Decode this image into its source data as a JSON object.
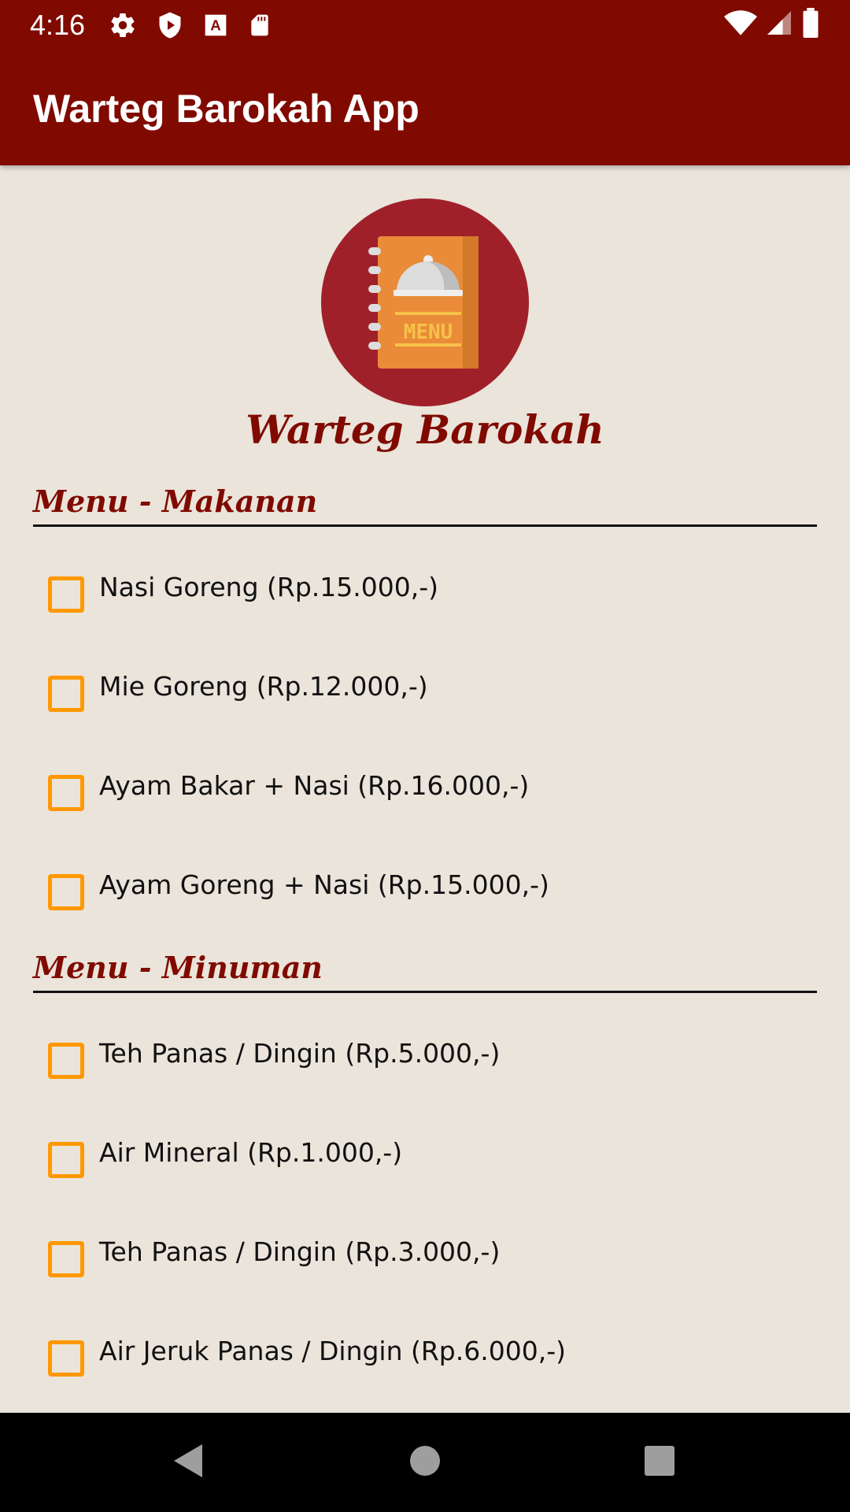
{
  "status_bar": {
    "time": "4:16",
    "left_icons": [
      "gear-icon",
      "shield-play-icon",
      "font-a-icon",
      "sd-card-icon"
    ],
    "right_icons": [
      "wifi-icon",
      "signal-icon",
      "battery-icon"
    ]
  },
  "app_bar": {
    "title": "Warteg Barokah App",
    "color": "#800A00"
  },
  "logo": {
    "icon": "menu-book-icon",
    "text": "MENU"
  },
  "brand_name": "Warteg Barokah",
  "sections": [
    {
      "title": "Menu - Makanan",
      "items": [
        {
          "label": "Nasi Goreng (Rp.15.000,-)",
          "checked": false
        },
        {
          "label": "Mie Goreng (Rp.12.000,-)",
          "checked": false
        },
        {
          "label": "Ayam Bakar + Nasi (Rp.16.000,-)",
          "checked": false
        },
        {
          "label": "Ayam Goreng + Nasi (Rp.15.000,-)",
          "checked": false
        }
      ]
    },
    {
      "title": "Menu - Minuman",
      "items": [
        {
          "label": "Teh Panas / Dingin (Rp.5.000,-)",
          "checked": false
        },
        {
          "label": "Air Mineral (Rp.1.000,-)",
          "checked": false
        },
        {
          "label": "Teh Panas / Dingin (Rp.3.000,-)",
          "checked": false
        },
        {
          "label": "Air Jeruk Panas / Dingin (Rp.6.000,-)",
          "checked": false
        }
      ]
    }
  ],
  "nav_bar": {
    "buttons": [
      "back-icon",
      "home-icon",
      "recents-icon"
    ]
  },
  "colors": {
    "primary": "#800A00",
    "background": "#EAE4DA",
    "checkbox": "#FF9800"
  }
}
